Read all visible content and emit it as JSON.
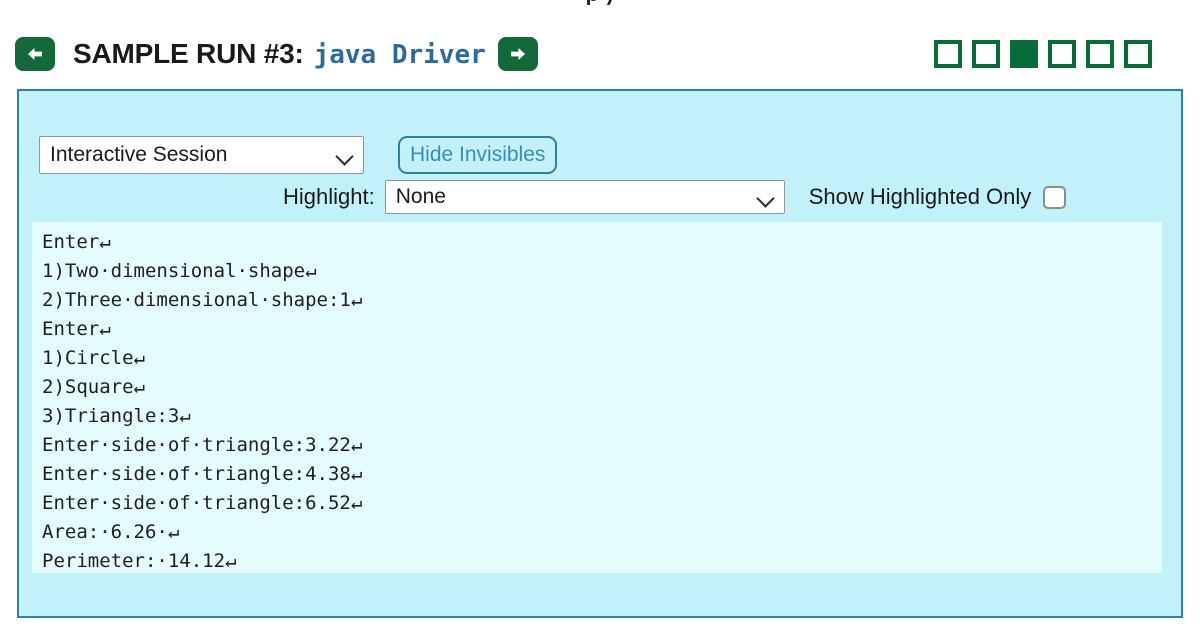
{
  "top_partial_text": "p )",
  "header": {
    "prev_button": {
      "name": "previous-sample-run",
      "glyph": "arrow-left"
    },
    "next_button": {
      "name": "next-sample-run",
      "glyph": "arrow-right"
    },
    "title": "SAMPLE RUN #3:",
    "command": "java Driver",
    "accent_green": "#096b38",
    "command_color": "#2a6b9c"
  },
  "steps": {
    "total": 6,
    "current_index": 3,
    "items": [
      {
        "label": "1",
        "filled": false
      },
      {
        "label": "2",
        "filled": false
      },
      {
        "label": "3",
        "filled": true
      },
      {
        "label": "4",
        "filled": false
      },
      {
        "label": "5",
        "filled": false
      },
      {
        "label": "6",
        "filled": false
      }
    ]
  },
  "controls": {
    "session_select": {
      "value": "Interactive Session",
      "options": [
        "Interactive Session"
      ]
    },
    "hide_invisibles_button": "Hide Invisibles",
    "highlight_label": "Highlight:",
    "highlight_select": {
      "value": "None",
      "options": [
        "None"
      ]
    },
    "show_highlighted_only_label": "Show Highlighted Only",
    "show_highlighted_only_checked": false
  },
  "console": {
    "background": "#e5fcfd",
    "space_glyph": "·",
    "newline_glyph": "↵",
    "lines": [
      "Enter↵",
      "1)Two·dimensional·shape↵",
      "2)Three·dimensional·shape:1↵",
      "Enter↵",
      "1)Circle↵",
      "2)Square↵",
      "3)Triangle:3↵",
      "Enter·side·of·triangle:3.22↵",
      "Enter·side·of·triangle:4.38↵",
      "Enter·side·of·triangle:6.52↵",
      "Area:·6.26·↵",
      "Perimeter:·14.12↵"
    ]
  },
  "panel": {
    "background": "#c2f1fa",
    "border_color": "#2b7fb5"
  }
}
